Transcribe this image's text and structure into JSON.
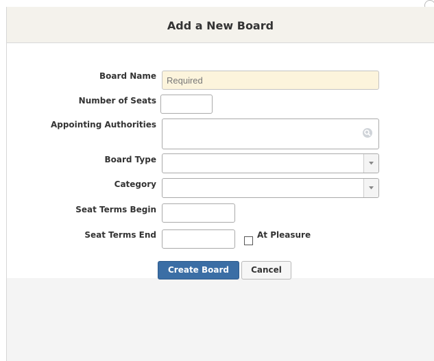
{
  "dialog": {
    "title": "Add a New Board"
  },
  "form": {
    "board_name": {
      "label": "Board Name",
      "value": "",
      "placeholder": "Required"
    },
    "number_of_seats": {
      "label": "Number of Seats",
      "value": ""
    },
    "appointing_authorities": {
      "label": "Appointing Authorities",
      "icon": "search-icon"
    },
    "board_type": {
      "label": "Board Type",
      "selected": ""
    },
    "category": {
      "label": "Category",
      "selected": ""
    },
    "seat_terms_begin": {
      "label": "Seat Terms Begin",
      "value": ""
    },
    "seat_terms_end": {
      "label": "Seat Terms End",
      "value": ""
    },
    "at_pleasure": {
      "label": "At Pleasure",
      "checked": false
    }
  },
  "buttons": {
    "create_label": "Create Board",
    "cancel_label": "Cancel"
  },
  "colors": {
    "primary_button": "#3b6ea5",
    "required_field_bg": "#fcf4dc"
  }
}
